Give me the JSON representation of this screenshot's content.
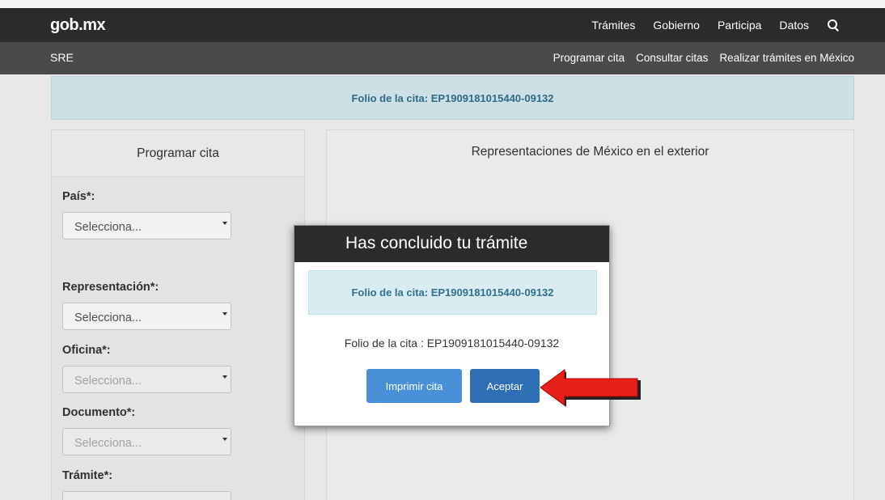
{
  "topbar": {
    "logo": "gob.mx",
    "nav": [
      "Trámites",
      "Gobierno",
      "Participa",
      "Datos"
    ]
  },
  "subbar": {
    "brand": "SRE",
    "nav": [
      "Programar cita",
      "Consultar citas",
      "Realizar trámites en México"
    ]
  },
  "alert": {
    "text": "Folio de la cita: EP1909181015440-09132"
  },
  "left_panel": {
    "title": "Programar cita",
    "fields": [
      {
        "label": "País*:",
        "placeholder": "Selecciona..."
      },
      {
        "label": "Representación*:",
        "placeholder": "Selecciona..."
      },
      {
        "label": "Oficina*:",
        "placeholder": "Selecciona..."
      },
      {
        "label": "Documento*:",
        "placeholder": "Selecciona..."
      },
      {
        "label": "Trámite*:",
        "placeholder": ""
      }
    ]
  },
  "right_panel": {
    "title": "Representaciones de México en el exterior"
  },
  "modal": {
    "title": "Has concluido tu trámite",
    "alert": "Folio de la cita: EP1909181015440-09132",
    "text": "Folio de la cita : EP1909181015440-09132",
    "print_label": "Imprimir cita",
    "ok_label": "Aceptar"
  },
  "colors": {
    "accent": "#2f6fb3",
    "arrow": "#e8201a",
    "alert_bg": "#d9ecf2"
  }
}
